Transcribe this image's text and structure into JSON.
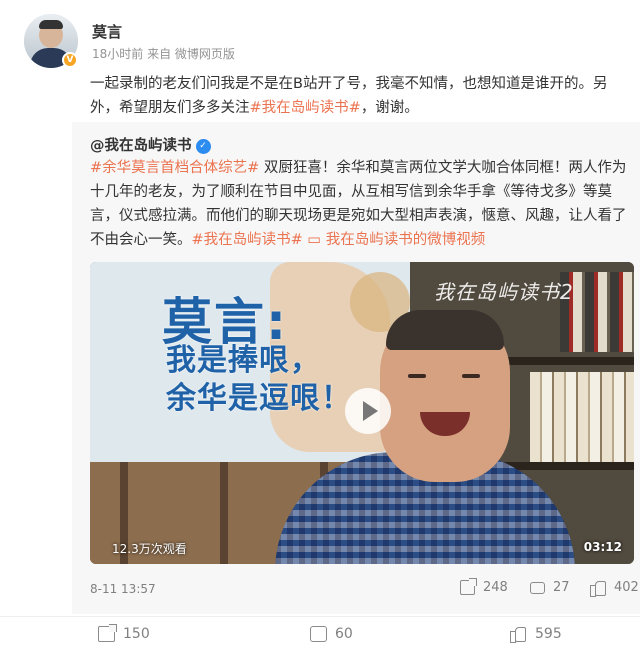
{
  "post": {
    "author": "莫言",
    "meta": "18小时前 来自 微博网页版",
    "text_parts": [
      {
        "text": "一起录制的老友们问我是不是在B站开了号，我毫不知情，也想知道是谁开的。另外，希望朋友们多多关注"
      },
      {
        "text": "#我在岛屿读书#",
        "tag": true
      },
      {
        "text": "，谢谢。"
      }
    ]
  },
  "repost": {
    "author": "@我在岛屿读书",
    "t1": "#余华莫言首档合体综艺#",
    "t2": " 双厨狂喜！余华和莫言两位文学大咖合体同框！两人作为十几年的老友，为了顺利在节目中见面，从互相写信到余华手拿《等待戈多》等莫言，仪式感拉满。而他们的聊天现场更是宛如大型相声表演，惬意、风趣，让人看了不由会心一笑。",
    "t3": "#我在岛屿读书#",
    "t4": " ▭ 我在岛屿读书的微博视频",
    "video": {
      "title_big": "莫言:",
      "title_line1": "我是捧哏，",
      "title_line2": "余华是逗哏！",
      "logo": "我在岛屿读书2",
      "views": "12.3万次观看",
      "duration": "03:12"
    },
    "date": "8-11 13:57",
    "shares": "248",
    "comments": "27",
    "likes": "402"
  },
  "actions": {
    "shares": "150",
    "comments": "60",
    "likes": "595"
  }
}
